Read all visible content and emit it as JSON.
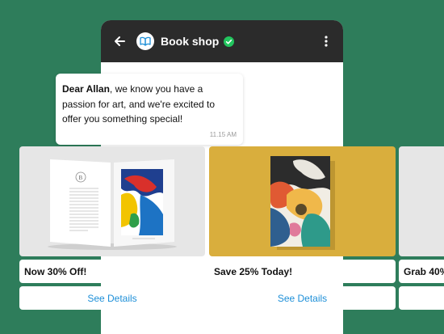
{
  "header": {
    "title": "Book shop"
  },
  "message": {
    "greeting_name": "Dear Allan",
    "body": ", we know you have a passion for art, and we're excited to offer you something special!",
    "time": "11.15 AM"
  },
  "cards": [
    {
      "label": "Now 30% Off!",
      "button": "See Details",
      "bg": "#e6e6e6"
    },
    {
      "label": "Save 25% Today!",
      "button": "See Details",
      "bg": "#d9ae3d"
    },
    {
      "label": "Grab 40%",
      "button": "",
      "bg": "#e6e6e6"
    }
  ],
  "colors": {
    "background": "#2e7d5b",
    "header": "#2b2b2b",
    "link": "#1d8fd8",
    "verified": "#22c55e"
  }
}
